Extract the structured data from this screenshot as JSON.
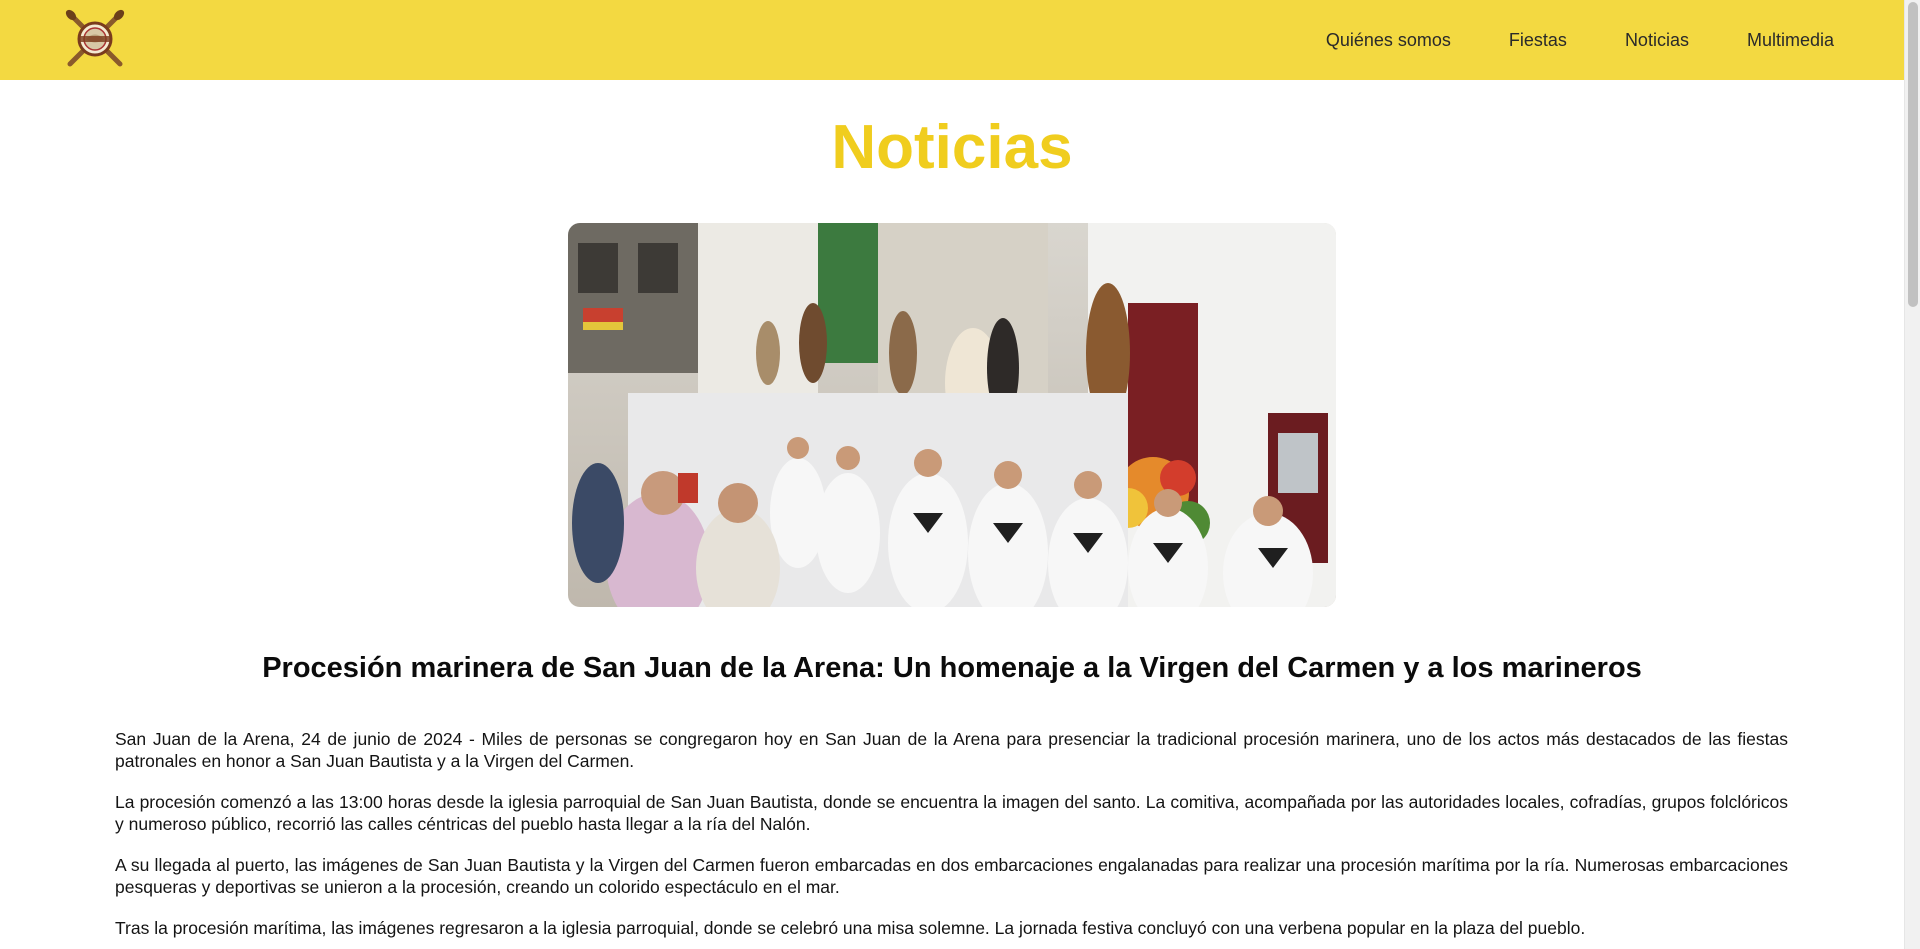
{
  "nav": {
    "logo_icon": "crossed-oars-emblem",
    "items": [
      {
        "label": "Quiénes somos"
      },
      {
        "label": "Fiestas"
      },
      {
        "label": "Noticias"
      },
      {
        "label": "Multimedia"
      }
    ]
  },
  "page": {
    "title": "Noticias"
  },
  "hero": {
    "image": "procession-photo"
  },
  "article": {
    "title": "Procesión marinera de San Juan de la Arena: Un homenaje a la Virgen del Carmen y a los marineros",
    "paragraphs": [
      "San Juan de la Arena, 24 de junio de 2024 - Miles de personas se congregaron hoy en San Juan de la Arena para presenciar la tradicional procesión marinera, uno de los actos más destacados de las fiestas patronales en honor a San Juan Bautista y a la Virgen del Carmen.",
      "La procesión comenzó a las 13:00 horas desde la iglesia parroquial de San Juan Bautista, donde se encuentra la imagen del santo. La comitiva, acompañada por las autoridades locales, cofradías, grupos folclóricos y numeroso público, recorrió las calles céntricas del pueblo hasta llegar a la ría del Nalón.",
      "A su llegada al puerto, las imágenes de San Juan Bautista y la Virgen del Carmen fueron embarcadas en dos embarcaciones engalanadas para realizar una procesión marítima por la ría. Numerosas embarcaciones pesqueras y deportivas se unieron a la procesión, creando un colorido espectáculo en el mar.",
      "Tras la procesión marítima, las imágenes regresaron a la iglesia parroquial, donde se celebró una misa solemne. La jornada festiva concluyó con una verbena popular en la plaza del pueblo."
    ]
  },
  "colors": {
    "navbar_bg": "#f3d941",
    "title_yellow": "#f0cd1e"
  }
}
